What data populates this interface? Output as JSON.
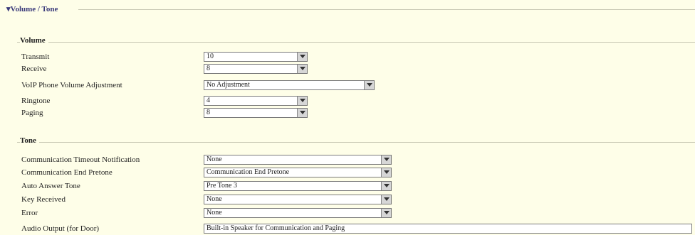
{
  "section": {
    "title": "▾Volume / Tone"
  },
  "volume": {
    "title": "Volume",
    "rows": [
      {
        "label": "Transmit",
        "value": "10"
      },
      {
        "label": "Receive",
        "value": "8"
      },
      {
        "label": "VoIP Phone Volume Adjustment",
        "value": "No Adjustment"
      },
      {
        "label": "Ringtone",
        "value": "4"
      },
      {
        "label": "Paging",
        "value": "8"
      }
    ]
  },
  "tone": {
    "title": "Tone",
    "rows": [
      {
        "label": "Communication Timeout Notification",
        "value": "None"
      },
      {
        "label": "Communication End Pretone",
        "value": "Communication End Pretone"
      },
      {
        "label": "Auto Answer Tone",
        "value": "Pre Tone 3"
      },
      {
        "label": "Key Received",
        "value": "None"
      },
      {
        "label": "Error",
        "value": "None"
      },
      {
        "label": "Audio Output (for Door)",
        "value": "Built-in Speaker for Communication and Paging"
      }
    ]
  },
  "icons": {
    "dropdown": "chevron-down-icon"
  }
}
